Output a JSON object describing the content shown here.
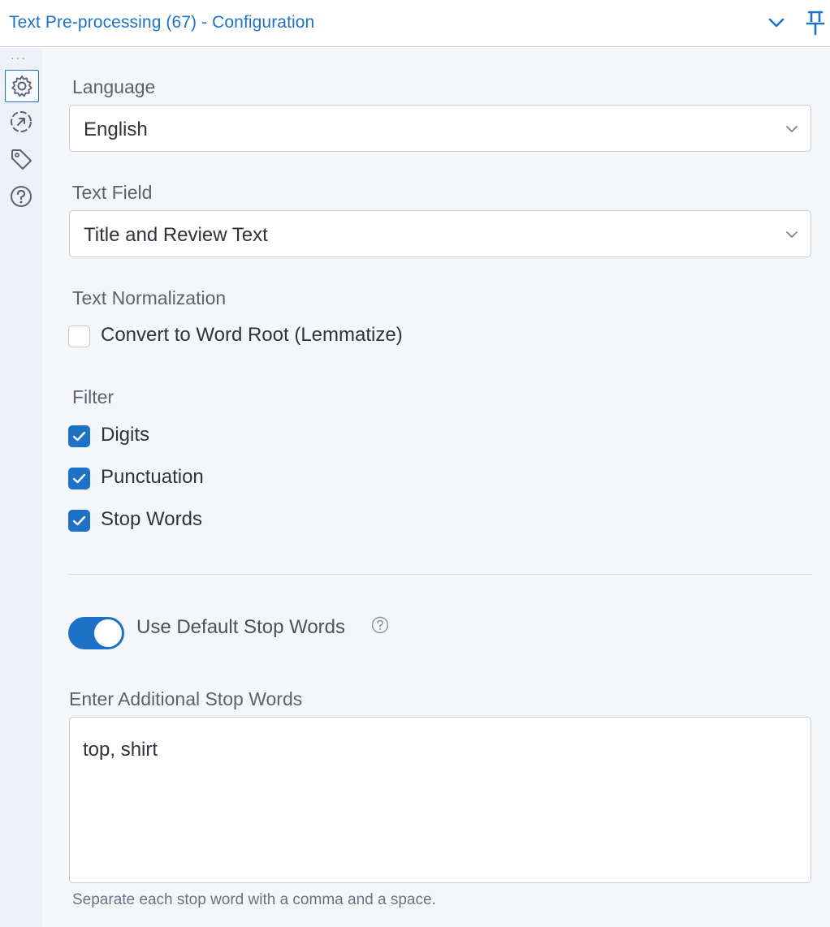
{
  "header": {
    "title": "Text Pre-processing (67) - Configuration",
    "accent_color": "#1d72c8",
    "icons": [
      "chevron-down-icon",
      "pin-icon"
    ]
  },
  "rail": {
    "items": [
      {
        "icon": "gear-icon",
        "active": true
      },
      {
        "icon": "connection-arrow-icon",
        "active": false
      },
      {
        "icon": "tag-icon",
        "active": false
      },
      {
        "icon": "help-icon",
        "active": false
      }
    ]
  },
  "form": {
    "language": {
      "label": "Language",
      "value": "English"
    },
    "text_field": {
      "label": "Text Field",
      "value": "Title and Review Text"
    },
    "normalization": {
      "label": "Text Normalization",
      "lemmatize": {
        "label": "Convert to Word Root (Lemmatize)",
        "checked": false
      }
    },
    "filter": {
      "label": "Filter",
      "digits": {
        "label": "Digits",
        "checked": true
      },
      "punctuation": {
        "label": "Punctuation",
        "checked": true
      },
      "stop_words": {
        "label": "Stop Words",
        "checked": true
      }
    },
    "default_stop_words": {
      "label": "Use Default Stop Words",
      "enabled": true
    },
    "additional_stop_words": {
      "label": "Enter Additional Stop Words",
      "value": "top, shirt",
      "hint": "Separate each stop word with a comma and a space."
    }
  }
}
